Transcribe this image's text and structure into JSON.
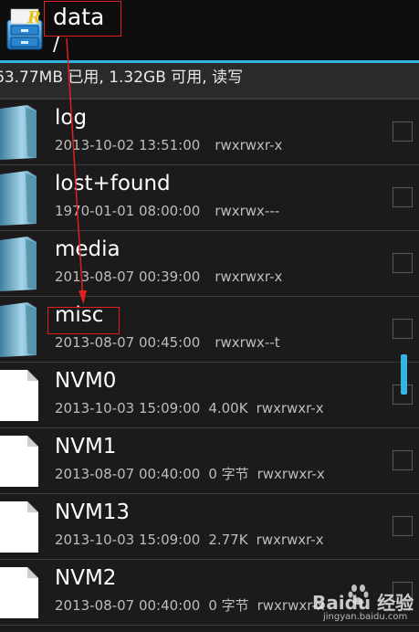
{
  "header": {
    "path_title": "data",
    "path_sub": "/"
  },
  "storage": {
    "text": "63.77MB 已用, 1.32GB 可用, 读写"
  },
  "files": [
    {
      "name": "log",
      "date": "2013-10-02 13:51:00",
      "size": "",
      "perms": "rwxrwxr-x",
      "kind": "folder"
    },
    {
      "name": "lost+found",
      "date": "1970-01-01 08:00:00",
      "size": "",
      "perms": "rwxrwx---",
      "kind": "folder"
    },
    {
      "name": "media",
      "date": "2013-08-07 00:39:00",
      "size": "",
      "perms": "rwxrwxr-x",
      "kind": "folder"
    },
    {
      "name": "misc",
      "date": "2013-08-07 00:45:00",
      "size": "",
      "perms": "rwxrwx--t",
      "kind": "folder"
    },
    {
      "name": "NVM0",
      "date": "2013-10-03 15:09:00",
      "size": "4.00K",
      "perms": "rwxrwxr-x",
      "kind": "file"
    },
    {
      "name": "NVM1",
      "date": "2013-08-07 00:40:00",
      "size": "0 字节",
      "perms": "rwxrwxr-x",
      "kind": "file"
    },
    {
      "name": "NVM13",
      "date": "2013-10-03 15:09:00",
      "size": "2.77K",
      "perms": "rwxrwxr-x",
      "kind": "file"
    },
    {
      "name": "NVM2",
      "date": "2013-08-07 00:40:00",
      "size": "0 字节",
      "perms": "rwxrwxr-x",
      "kind": "file"
    }
  ],
  "watermark": {
    "text": "Baidu 经验",
    "sub": "jingyan.baidu.com"
  },
  "colors": {
    "accent": "#33b5e5",
    "annotation": "#e02020"
  }
}
